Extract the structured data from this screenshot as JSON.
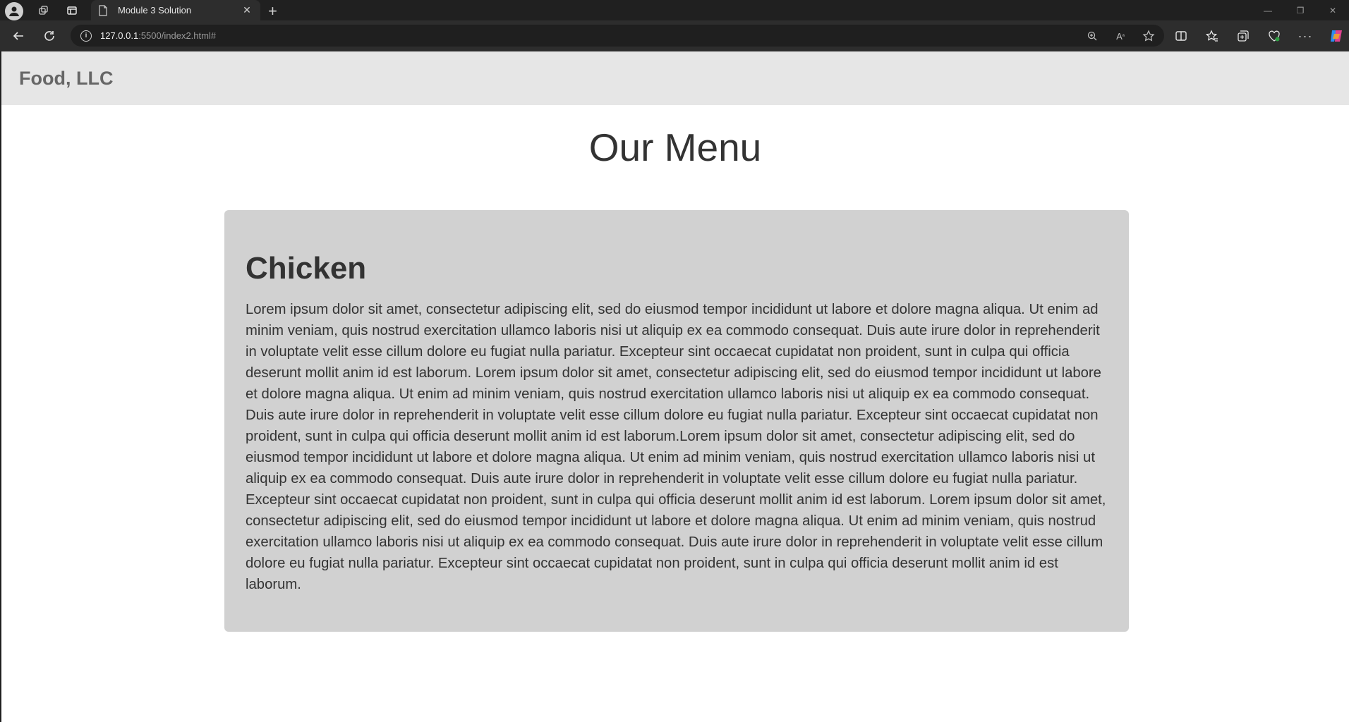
{
  "browser": {
    "tab_title": "Module 3 Solution",
    "url_host": "127.0.0.1",
    "url_rest": ":5500/index2.html#"
  },
  "page": {
    "brand": "Food, LLC",
    "title": "Our Menu",
    "section": {
      "heading": "Chicken",
      "body": "Lorem ipsum dolor sit amet, consectetur adipiscing elit, sed do eiusmod tempor incididunt ut labore et dolore magna aliqua. Ut enim ad minim veniam, quis nostrud exercitation ullamco laboris nisi ut aliquip ex ea commodo consequat. Duis aute irure dolor in reprehenderit in voluptate velit esse cillum dolore eu fugiat nulla pariatur. Excepteur sint occaecat cupidatat non proident, sunt in culpa qui officia deserunt mollit anim id est laborum. Lorem ipsum dolor sit amet, consectetur adipiscing elit, sed do eiusmod tempor incididunt ut labore et dolore magna aliqua. Ut enim ad minim veniam, quis nostrud exercitation ullamco laboris nisi ut aliquip ex ea commodo consequat. Duis aute irure dolor in reprehenderit in voluptate velit esse cillum dolore eu fugiat nulla pariatur. Excepteur sint occaecat cupidatat non proident, sunt in culpa qui officia deserunt mollit anim id est laborum.Lorem ipsum dolor sit amet, consectetur adipiscing elit, sed do eiusmod tempor incididunt ut labore et dolore magna aliqua. Ut enim ad minim veniam, quis nostrud exercitation ullamco laboris nisi ut aliquip ex ea commodo consequat. Duis aute irure dolor in reprehenderit in voluptate velit esse cillum dolore eu fugiat nulla pariatur. Excepteur sint occaecat cupidatat non proident, sunt in culpa qui officia deserunt mollit anim id est laborum. Lorem ipsum dolor sit amet, consectetur adipiscing elit, sed do eiusmod tempor incididunt ut labore et dolore magna aliqua. Ut enim ad minim veniam, quis nostrud exercitation ullamco laboris nisi ut aliquip ex ea commodo consequat. Duis aute irure dolor in reprehenderit in voluptate velit esse cillum dolore eu fugiat nulla pariatur. Excepteur sint occaecat cupidatat non proident, sunt in culpa qui officia deserunt mollit anim id est laborum."
    }
  },
  "icons": [
    "profile-icon",
    "workspaces-icon",
    "tab-actions-icon",
    "page-icon",
    "close-icon",
    "new-tab-icon",
    "minimize-icon",
    "restore-icon",
    "window-close-icon",
    "back-icon",
    "reload-icon",
    "site-info-icon",
    "zoom-icon",
    "read-aloud-icon",
    "favorite-star-icon",
    "split-screen-icon",
    "favorites-icon",
    "collections-icon",
    "browser-essentials-icon",
    "more-icon",
    "copilot-icon"
  ]
}
